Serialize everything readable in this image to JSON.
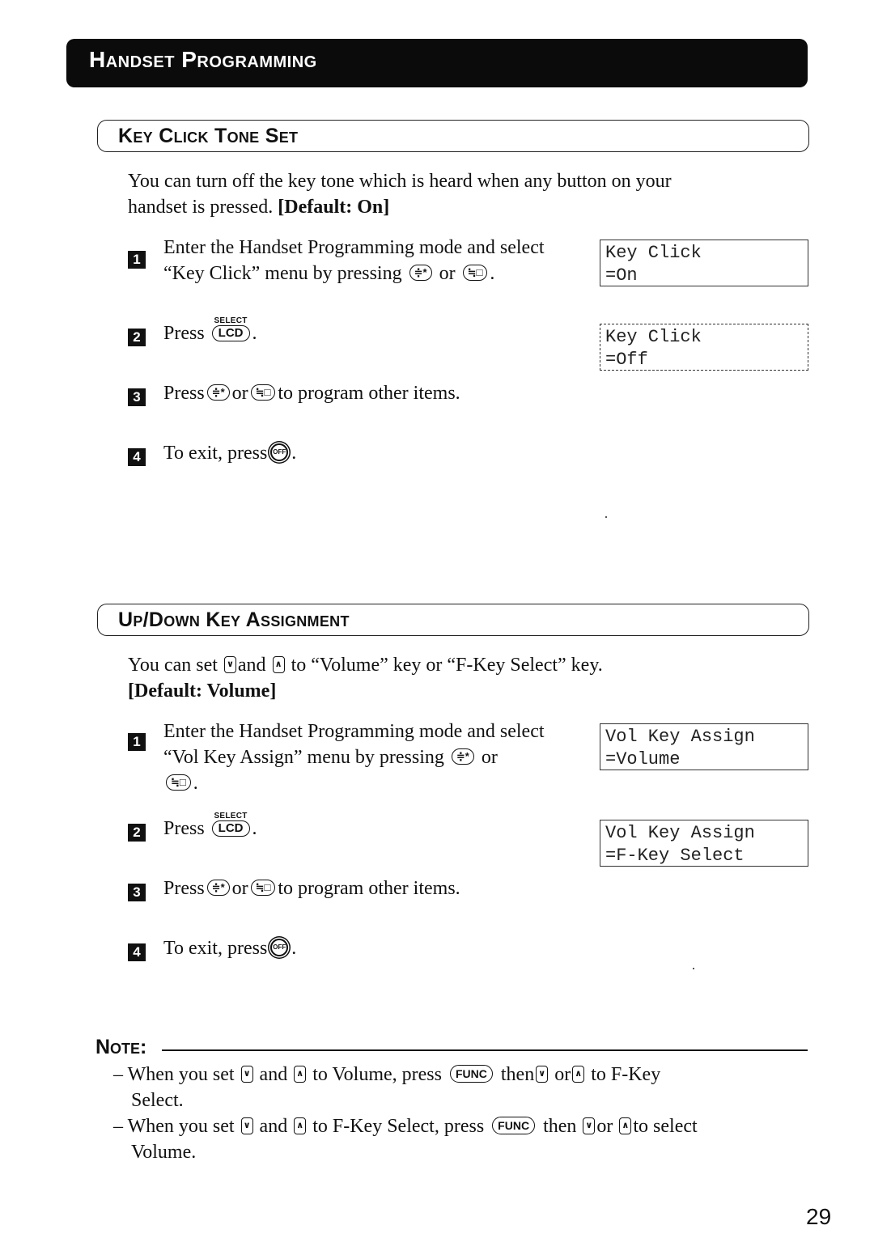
{
  "header": {
    "title": "Handset Programming"
  },
  "sections": [
    {
      "title": "Key Click Tone Set",
      "intro_line1": "You can turn off the key tone which is heard when any button on your",
      "intro_line2": "handset is pressed.",
      "default_label": "[Default: On]",
      "steps": [
        {
          "number": "1",
          "line1": "Enter the Handset Programming mode and select",
          "line2_before": "“Key Click” menu by pressing",
          "or": "or",
          "end": "."
        },
        {
          "number": "2",
          "text": "Press",
          "end": "."
        },
        {
          "number": "3",
          "text_before": "Press",
          "or": "or",
          "text_after": "to program other items."
        },
        {
          "number": "4",
          "text": "To exit, press",
          "end": "."
        }
      ],
      "displays": [
        {
          "line1": "Key Click",
          "line2": "=On"
        },
        {
          "line1": "Key Click",
          "line2": "=Off"
        }
      ]
    },
    {
      "title": "Up/Down Key Assignment",
      "intro_before": "You can set",
      "intro_and": "and",
      "intro_after": "to “Volume” key or “F-Key Select” key.",
      "default_label": "[Default: Volume]",
      "steps": [
        {
          "number": "1",
          "line1": "Enter the Handset Programming mode and select",
          "line2_before": "“Vol Key Assign” menu by pressing",
          "or": "or",
          "end": "."
        },
        {
          "number": "2",
          "text": "Press",
          "end": "."
        },
        {
          "number": "3",
          "text_before": "Press",
          "or": "or",
          "text_after": "to program other items."
        },
        {
          "number": "4",
          "text": "To exit, press",
          "end": "."
        }
      ],
      "displays": [
        {
          "line1": "Vol Key Assign",
          "line2": "=Volume"
        },
        {
          "line1": "Vol Key Assign",
          "line2": "=F-Key Select"
        }
      ]
    }
  ],
  "keys": {
    "up_star": "≑*",
    "down_hash": "≒□",
    "select_label": "SELECT",
    "lcd_label": "LCD",
    "off_label": "OFF",
    "func_label": "FUNC",
    "down_arrow": "∨",
    "up_arrow": "∧"
  },
  "note": {
    "title": "Note:",
    "items": [
      {
        "dash": "–",
        "p1": "When you set",
        "p2": "and",
        "p3": "to Volume, press",
        "p4": "then",
        "p5": "or",
        "p6": "to F-Key",
        "line2": "Select."
      },
      {
        "dash": "–",
        "p1": "When you set",
        "p2": "and",
        "p3": "to F-Key Select, press",
        "p4": "then",
        "p5": "or",
        "p6": "to select",
        "line2": "Volume."
      }
    ]
  },
  "page_number": "29"
}
